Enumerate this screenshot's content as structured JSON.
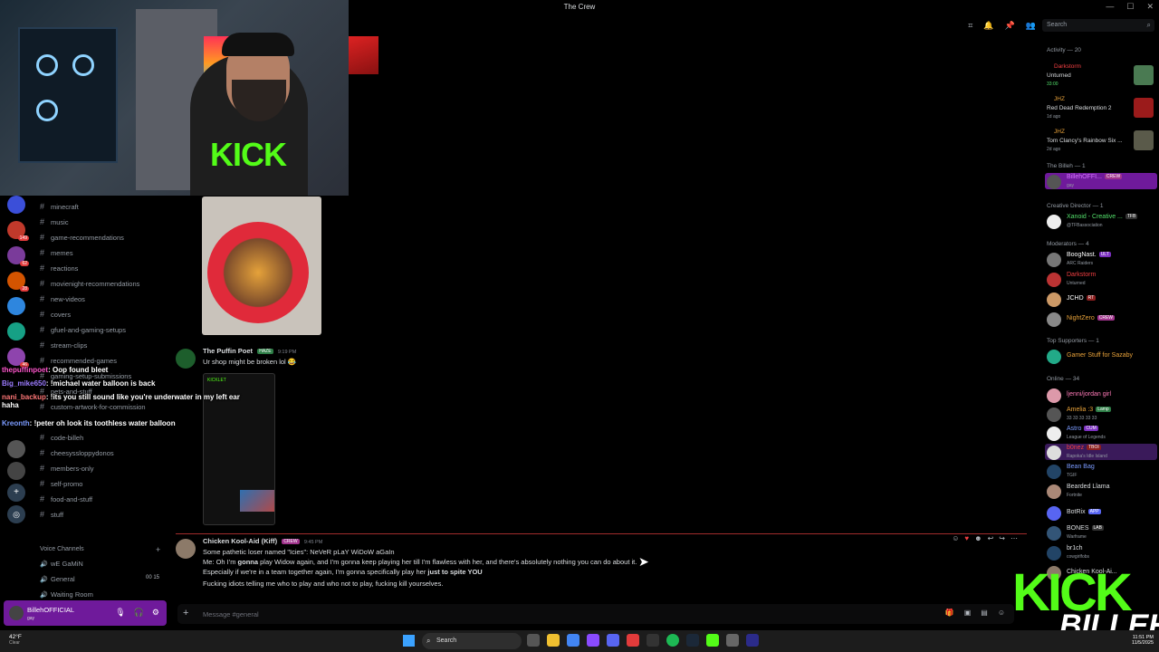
{
  "window": {
    "title": "The Crew"
  },
  "search": {
    "placeholder": "Search"
  },
  "channels": [
    "minecraft",
    "music",
    "game-recommendations",
    "memes",
    "reactions",
    "movienight-recommendations",
    "new-videos",
    "covers",
    "gfuel-and-gaming-setups",
    "stream-clips",
    "recommended-games",
    "gaming-setup-submissions",
    "pets-and-stuff",
    "custom-artwork-for-commission",
    "code-billeh",
    "cheesyssloppydonos",
    "members-only",
    "self-promo",
    "food-and-stuff",
    "stuff"
  ],
  "voice": {
    "header": "Voice Channels",
    "items": [
      {
        "name": "wE GaMiN",
        "count": ""
      },
      {
        "name": "General",
        "count": "00 15"
      },
      {
        "name": "Waiting Room",
        "count": ""
      }
    ]
  },
  "user_panel": {
    "name": "BillehOFFICIAL",
    "status": "gay"
  },
  "messages": {
    "m1": {
      "author": "The Puffin Poet",
      "tag": "HAZE",
      "time": "9:19 PM",
      "text": "Ur shop might be broken lol 😂",
      "phone_title": "KICKLET"
    },
    "m2": {
      "author": "Chicken Kool-Aid (Kiff)",
      "tag": "CREW",
      "time": "9:45 PM",
      "line1": "Some pathetic loser named \"Icies\": NeVeR pLaY WiDoW aGaIn",
      "line2a": "Me: Oh I'm ",
      "line2b": "gonna",
      "line2c": " play Widow again, and I'm gonna keep playing her till I'm flawless with her, and there's absolutely nothing you can do about it.",
      "line3a": "Especially if we're in a team together again, I'm gonna specifically play her ",
      "line3b": "just to spite YOU",
      "line4": "Fucking idiots telling me who to play and who not to play, fucking kill yourselves."
    }
  },
  "composer": {
    "placeholder": "Message #general"
  },
  "overlay_chat": [
    {
      "user": "thepuffinpoet",
      "msg": "Oop found bleet",
      "color": "#ff55cc"
    },
    {
      "user": "Big_mike650",
      "msg": "!michael water balloon is back",
      "color": "#9b7bff"
    },
    {
      "user": "nani_backup",
      "msg": "!its you still sound like you're underwater in my left ear haha",
      "color": "#ff7777"
    },
    {
      "user": "Kreonth",
      "msg": "!peter oh look its toothless water balloon",
      "color": "#7b9bff"
    }
  ],
  "members": {
    "activity_header": "Activity — 20",
    "activities": [
      {
        "name": "Darkstorm",
        "game": "Unturned",
        "time": "33:00",
        "color": "#f23f42"
      },
      {
        "name": "JHZ",
        "game": "Red Dead Redemption 2",
        "time": "1d ago",
        "color": "#e8a23a"
      },
      {
        "name": "JHZ",
        "game": "Tom Clancy's Rainbow Six ...",
        "time": "2d ago",
        "color": "#e8a23a"
      }
    ],
    "sections": [
      {
        "header": "The Billeh — 1",
        "list": [
          {
            "name": "BillehOFFI...",
            "tag": "CREW",
            "sub": "gay",
            "color": "#d673ff"
          }
        ]
      },
      {
        "header": "Creative Director — 1",
        "list": [
          {
            "name": "Xanoid - Creative ...",
            "tag": "TFB",
            "sub": "@TFBassociation",
            "color": "#53e06b"
          }
        ]
      },
      {
        "header": "Moderators — 4",
        "list": [
          {
            "name": "BoogNast.",
            "tag": "ULT",
            "sub": "ARC Raiders",
            "color": "#ffffff"
          },
          {
            "name": "Darkstorm",
            "tag": "",
            "sub": "Unturned",
            "color": "#f23f42"
          },
          {
            "name": "JCHD",
            "tag": "RT",
            "sub": "",
            "color": "#ffffff"
          },
          {
            "name": "NightZero",
            "tag": "CREW",
            "sub": "",
            "color": "#e8a23a"
          }
        ]
      },
      {
        "header": "Top Supporters — 1",
        "list": [
          {
            "name": "Gamer Stuff for Sazaby",
            "tag": "",
            "sub": "",
            "color": "#e8a23a"
          }
        ]
      },
      {
        "header": "Online — 34",
        "list": [
          {
            "name": "ljenni/jordan girl",
            "tag": "",
            "sub": "",
            "color": "#ff7ab8"
          },
          {
            "name": "Amelia :3",
            "tag": "Lamp",
            "sub": "33 33 33 33 33",
            "color": "#e8a23a"
          },
          {
            "name": "Astro",
            "tag": "CUM",
            "sub": "League of Legends",
            "color": "#7b9bff"
          },
          {
            "name": "b0nez",
            "tag": "TBOI",
            "sub": "Rapoka's Idle Island",
            "color": "#f23f42"
          },
          {
            "name": "Bean Bag",
            "tag": "",
            "sub": "TGIF",
            "color": "#7b9bff"
          },
          {
            "name": "Bearded Llama",
            "tag": "",
            "sub": "Fortnite",
            "color": "#dbdee1"
          },
          {
            "name": "BotRix",
            "tag": "APP",
            "sub": "",
            "color": "#dbdee1"
          },
          {
            "name": "BONES",
            "tag": "LAB",
            "sub": "Warframe",
            "color": "#dbdee1"
          },
          {
            "name": "br1ch",
            "tag": "",
            "sub": "cowgirlfobs",
            "color": "#dbdee1"
          },
          {
            "name": "Chicken Kool-Ai...",
            "tag": "",
            "sub": "",
            "color": "#dbdee1"
          }
        ]
      }
    ]
  },
  "overlay": {
    "kick": "KICK",
    "name": "BILLEH"
  },
  "webcam": {
    "shirt_text": "KICK"
  },
  "taskbar": {
    "temp": "42°F",
    "weather": "Clear",
    "search": "Search",
    "time": "11:51 PM",
    "date": "11/5/2025"
  }
}
